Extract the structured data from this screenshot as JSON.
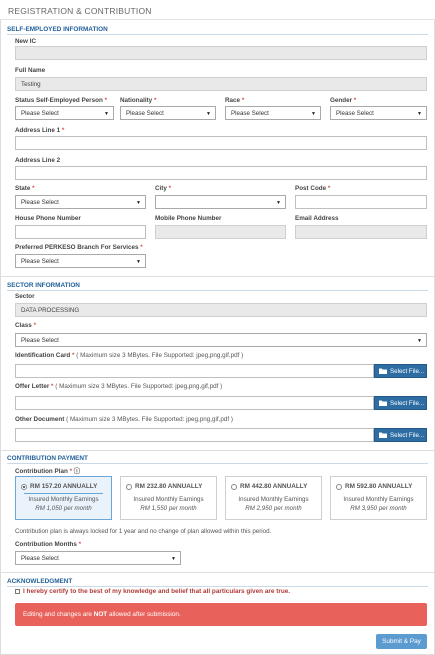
{
  "header": {
    "title": "REGISTRATION & CONTRIBUTION"
  },
  "self_employed": {
    "section_title": "SELF-EMPLOYED INFORMATION",
    "new_ic": {
      "label": "New IC",
      "value": ""
    },
    "full_name": {
      "label": "Full Name",
      "value": "Testing"
    },
    "status": {
      "label": "Status Self-Employed Person",
      "value": "Please Select"
    },
    "nationality": {
      "label": "Nationality",
      "value": "Please Select"
    },
    "race": {
      "label": "Race",
      "value": "Please Select"
    },
    "gender": {
      "label": "Gender",
      "value": "Please Select"
    },
    "address1": {
      "label": "Address Line 1",
      "value": ""
    },
    "address2": {
      "label": "Address Line 2",
      "value": ""
    },
    "state": {
      "label": "State",
      "value": "Please Select"
    },
    "city": {
      "label": "City",
      "value": ""
    },
    "postcode": {
      "label": "Post Code",
      "value": ""
    },
    "house_phone": {
      "label": "House Phone Number",
      "value": ""
    },
    "mobile_phone": {
      "label": "Mobile Phone Number",
      "value": ""
    },
    "email": {
      "label": "Email Address",
      "value": ""
    },
    "branch": {
      "label": "Preferred PERKESO Branch For Services",
      "value": "Please Select"
    }
  },
  "sector": {
    "section_title": "SECTOR INFORMATION",
    "sector": {
      "label": "Sector",
      "value": "DATA PROCESSING"
    },
    "class": {
      "label": "Class",
      "value": "Please Select"
    },
    "id_card": {
      "label": "Identification Card",
      "hint": "( Maximum size 3 MBytes. File Supported: jpeg,png,gif,pdf )"
    },
    "offer_letter": {
      "label": "Offer Letter",
      "hint": "( Maximum size 3 MBytes. File Supported: jpeg,png,gif,pdf )"
    },
    "other_doc": {
      "label": "Other Document",
      "hint": "( Maximum size 3 MBytes. File Supported: jpeg,png,gif,pdf )"
    },
    "select_file_label": "Select File..."
  },
  "contribution": {
    "section_title": "CONTRIBUTION PAYMENT",
    "plan_label": "Contribution Plan",
    "plans": [
      {
        "amount": "RM 157.20 ANNUALLY",
        "insured": "Insured Monthly Earnings",
        "earnings": "RM 1,050 per month",
        "selected": true
      },
      {
        "amount": "RM 232.80 ANNUALLY",
        "insured": "Insured Monthly Earnings",
        "earnings": "RM 1,550 per month",
        "selected": false
      },
      {
        "amount": "RM 442.80 ANNUALLY",
        "insured": "Insured Monthly Earnings",
        "earnings": "RM 2,950 per month",
        "selected": false
      },
      {
        "amount": "RM 592.80 ANNUALLY",
        "insured": "Insured Monthly Earnings",
        "earnings": "RM 3,950 per month",
        "selected": false
      }
    ],
    "lock_note": "Contribution plan is always locked for 1 year and no change of plan allowed within this period.",
    "months": {
      "label": "Contribution Months",
      "value": "Please Select"
    }
  },
  "acknowledgement": {
    "section_title": "ACKNOWLEDGMENT",
    "checkbox_label": "I hereby certify to the best of my knowledge and belief that all particulars given are true.",
    "alert": {
      "before": "Editing and changes are ",
      "strong": "NOT",
      "after": " allowed after submission."
    }
  },
  "submit_label": "Submit & Pay",
  "colors": {
    "accent": "#1f5f98",
    "file_button": "#2e6da4",
    "alert": "#e8615a",
    "submit": "#5b9bd0",
    "required": "#d9534f"
  }
}
